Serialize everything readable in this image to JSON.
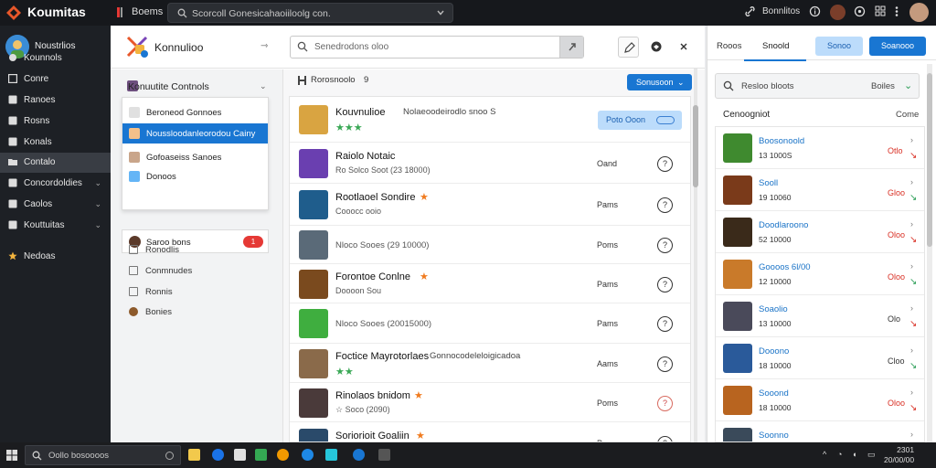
{
  "topbar": {
    "app_title": "Koumitas",
    "tab_label": "Boems",
    "search_text": "Scorcoll Gonesicahaoiiloolg con.",
    "user_label": "Bonnlitos"
  },
  "leftnav": {
    "profile_name": "Noustrlios",
    "items": [
      {
        "label": "Kounnols",
        "icon": "circle-icon",
        "chevron": ""
      },
      {
        "label": "Conre",
        "icon": "grid-icon",
        "chevron": ""
      },
      {
        "label": "Ranoes",
        "icon": "square-icon",
        "chevron": ""
      },
      {
        "label": "Rosns",
        "icon": "square-icon",
        "chevron": ""
      },
      {
        "label": "Konals",
        "icon": "square-icon",
        "chevron": ""
      },
      {
        "label": "Contalo",
        "icon": "folder-icon",
        "chevron": ""
      },
      {
        "label": "Concordoldies",
        "icon": "square-icon",
        "chevron": "⌄"
      },
      {
        "label": "Caolos",
        "icon": "square-icon",
        "chevron": "⌄"
      },
      {
        "label": "Kouttuitas",
        "icon": "square-icon",
        "chevron": "⌄"
      },
      {
        "label": "Nedoas",
        "icon": "star-icon",
        "chevron": ""
      }
    ]
  },
  "midpanel": {
    "title": "Konnulioo",
    "pin": "⇾",
    "search_placeholder": "Senedrodons oloo",
    "sidebar": {
      "head": "Konuutite Contnols",
      "dropdown_items": [
        {
          "label": "Beroneod Gonnoes",
          "selected": false
        },
        {
          "label": "Noussloodanleorodou Cainy",
          "selected": true
        },
        {
          "label": "Gofoaseiss Sanoes",
          "selected": false
        },
        {
          "label": "Donoos",
          "selected": false
        }
      ],
      "box_label": "Saroo bons",
      "box_badge": "1",
      "links": [
        {
          "label": "Ronodlis"
        },
        {
          "label": "Conmnudes"
        },
        {
          "label": "Ronnis"
        },
        {
          "label": "Bonies"
        }
      ]
    },
    "list": {
      "header": "Rorosnoolo",
      "header_count": "9",
      "sort_label": "Sonusoon",
      "rows": [
        {
          "name": "Kouvnulioe",
          "name_extra": "Nolaeoodeirodlo snoo S",
          "sub": "★★★",
          "price": "",
          "connect": "Poto Ooon",
          "action": ""
        },
        {
          "name": "Raiolo Notaic",
          "sub": "Ro Solco Soot (23 18000)",
          "price": "Oand",
          "action": "?"
        },
        {
          "name": "Rootlaoel Sondire",
          "sub": "Cooocc ooio",
          "price": "Pams",
          "action": "?"
        },
        {
          "name": "",
          "sub": "Nloco Sooes (29 10000)",
          "price": "Poms",
          "action": "?"
        },
        {
          "name": "Forontoe Conlne",
          "sub": "Doooon Sou",
          "price": "Pams",
          "action": "?"
        },
        {
          "name": "",
          "sub": "Nloco Sooes (20015000)",
          "price": "Pams",
          "action": "?"
        },
        {
          "name": "Foctice Mayrotorlaes",
          "name_extra": "Gonnocodeleloigicadoa",
          "sub": "★★",
          "price": "Aams",
          "action": "?"
        },
        {
          "name": "Rinolaos bnidom",
          "sub": "☆ Soco (2090)",
          "price": "Poms",
          "action": "?"
        },
        {
          "name": "Soriorioit Goaliin",
          "sub": "☆ Soco (13 21000)",
          "price": "Pams",
          "action": "?"
        }
      ]
    }
  },
  "rightpanel": {
    "tabs": [
      "Rooos",
      "Snoold"
    ],
    "btn_light": "Sonoo",
    "btn_primary": "Soanooo",
    "search_text": "Resloo bloots",
    "search_option": "Boiles",
    "section_head": "Cenoogniot",
    "section_head_right": "Come",
    "items": [
      {
        "name": "Boosonoold",
        "sub": "13 1000S",
        "val": "Otlo",
        "val_dark": false,
        "arrow": "↘"
      },
      {
        "name": "Sooll",
        "sub": "19 10060",
        "val": "Gloo",
        "val_dark": false,
        "arrow": "↘"
      },
      {
        "name": "Doodlaroono",
        "sub": "52 10000",
        "val": "Oloo",
        "val_dark": false,
        "arrow": "↘"
      },
      {
        "name": "Goooos 6l/00",
        "sub": "12 10000",
        "val": "Oloo",
        "val_dark": false,
        "arrow": "↘"
      },
      {
        "name": "Soaolio",
        "sub": "13 10000",
        "val": "Olo",
        "val_dark": true,
        "arrow": "↘"
      },
      {
        "name": "Dooono",
        "sub": "18 10000",
        "val": "Cloo",
        "val_dark": true,
        "arrow": "↘"
      },
      {
        "name": "Sooond",
        "sub": "18 10000",
        "val": "Oloo",
        "val_dark": false,
        "arrow": "↘"
      },
      {
        "name": "Soonno",
        "sub": "21 10000",
        "val": "",
        "val_dark": true,
        "arrow": ""
      }
    ]
  },
  "taskbar": {
    "search_text": "Oollo bosoooos",
    "clock_time": "2301",
    "clock_date": "20/00/00"
  }
}
